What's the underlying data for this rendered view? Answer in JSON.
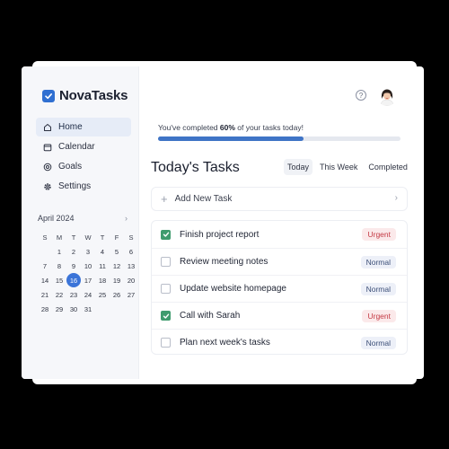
{
  "app": {
    "name": "NovaTasks"
  },
  "sidebar": {
    "items": [
      {
        "label": "Home",
        "icon": "home-icon",
        "active": true
      },
      {
        "label": "Calendar",
        "icon": "calendar-icon",
        "active": false
      },
      {
        "label": "Goals",
        "icon": "target-icon",
        "active": false
      },
      {
        "label": "Settings",
        "icon": "gear-icon",
        "active": false
      }
    ]
  },
  "calendar": {
    "month": "April 2024",
    "weekdays": [
      "S",
      "M",
      "T",
      "W",
      "T",
      "F",
      "S"
    ],
    "days": [
      "",
      "1",
      "2",
      "3",
      "4",
      "5",
      "6",
      "7",
      "8",
      "9",
      "10",
      "11",
      "12",
      "13",
      "14",
      "15",
      "16",
      "17",
      "18",
      "19",
      "20",
      "21",
      "22",
      "23",
      "24",
      "25",
      "26",
      "27",
      "28",
      "29",
      "30",
      "31",
      "",
      "",
      ""
    ],
    "today": "16"
  },
  "progress": {
    "prefix": "You've completed ",
    "percent_label": "60%",
    "suffix": " of your tasks today!",
    "value": 0.6
  },
  "main": {
    "title": "Today's Tasks",
    "tabs": [
      {
        "label": "Today",
        "active": true
      },
      {
        "label": "This Week",
        "active": false
      },
      {
        "label": "Completed",
        "active": false
      }
    ],
    "add_task_label": "Add New Task"
  },
  "tasks": [
    {
      "title": "Finish project report",
      "done": true,
      "priority": "Urgent"
    },
    {
      "title": "Review meeting notes",
      "done": false,
      "priority": "Normal"
    },
    {
      "title": "Update website homepage",
      "done": false,
      "priority": "Normal"
    },
    {
      "title": "Call with Sarah",
      "done": true,
      "priority": "Urgent"
    },
    {
      "title": "Plan next week's tasks",
      "done": false,
      "priority": "Normal"
    }
  ],
  "colors": {
    "accent": "#3b74d8",
    "done": "#3f9b6e",
    "urgent": "#c43a44",
    "normal": "#3c4f78"
  }
}
